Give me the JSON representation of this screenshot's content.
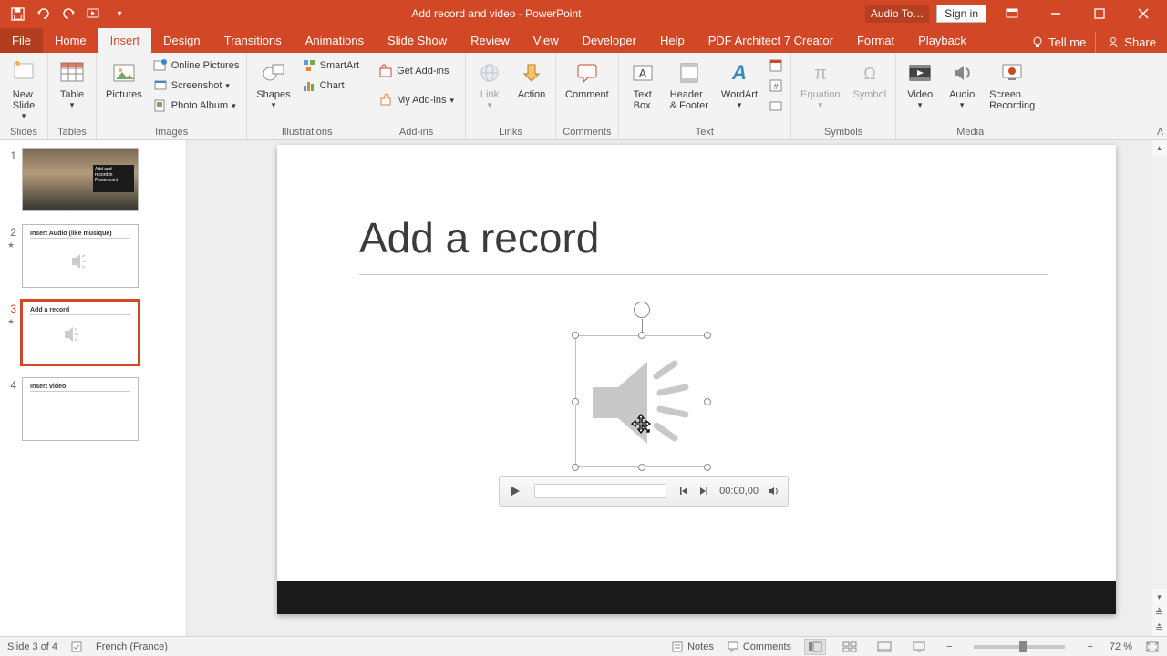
{
  "titlebar": {
    "doc_title": "Add record and video  -  PowerPoint",
    "contextual": "Audio To…",
    "signin": "Sign in"
  },
  "tabs": {
    "file": "File",
    "home": "Home",
    "insert": "Insert",
    "design": "Design",
    "transitions": "Transitions",
    "animations": "Animations",
    "slideshow": "Slide Show",
    "review": "Review",
    "view": "View",
    "developer": "Developer",
    "help": "Help",
    "pdf": "PDF Architect 7 Creator",
    "format": "Format",
    "playback": "Playback",
    "tellme": "Tell me",
    "share": "Share"
  },
  "ribbon": {
    "slides": {
      "new_slide": "New\nSlide",
      "group": "Slides"
    },
    "tables": {
      "table": "Table",
      "group": "Tables"
    },
    "images": {
      "pictures": "Pictures",
      "online": "Online Pictures",
      "screenshot": "Screenshot",
      "album": "Photo Album",
      "group": "Images"
    },
    "illustrations": {
      "shapes": "Shapes",
      "smartart": "SmartArt",
      "chart": "Chart",
      "group": "Illustrations"
    },
    "addins": {
      "get": "Get Add-ins",
      "my": "My Add-ins",
      "group": "Add-ins"
    },
    "links": {
      "link": "Link",
      "action": "Action",
      "group": "Links"
    },
    "comments": {
      "comment": "Comment",
      "group": "Comments"
    },
    "text": {
      "textbox": "Text\nBox",
      "headerfooter": "Header\n& Footer",
      "wordart": "WordArt",
      "group": "Text"
    },
    "symbols": {
      "equation": "Equation",
      "symbol": "Symbol",
      "group": "Symbols"
    },
    "media": {
      "video": "Video",
      "audio": "Audio",
      "screen": "Screen\nRecording",
      "group": "Media"
    }
  },
  "thumbs": [
    {
      "num": "1",
      "star": false,
      "title": "Add and record in Powerpoint"
    },
    {
      "num": "2",
      "star": true,
      "title": "Insert Audio (like musique)"
    },
    {
      "num": "3",
      "star": true,
      "title": "Add a record",
      "selected": true
    },
    {
      "num": "4",
      "star": false,
      "title": "Insert video"
    }
  ],
  "slide": {
    "title": "Add a record"
  },
  "mediabar": {
    "time": "00:00,00"
  },
  "statusbar": {
    "slide_pos": "Slide 3 of 4",
    "lang": "French (France)",
    "notes": "Notes",
    "comments": "Comments",
    "zoom": "72 %"
  }
}
